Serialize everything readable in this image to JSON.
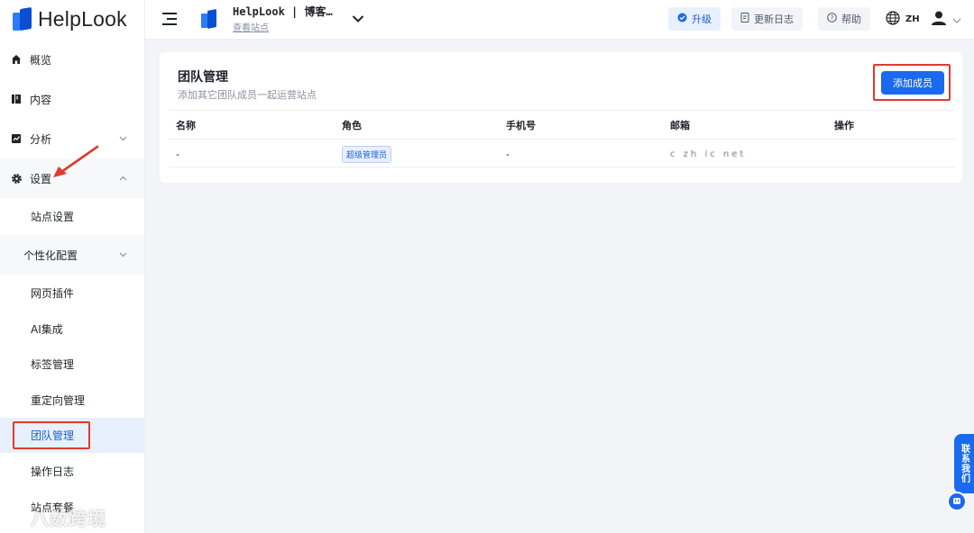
{
  "app": {
    "logo_text": "HelpLook"
  },
  "sidebar": {
    "items": [
      {
        "label": "概览",
        "icon": "home-icon"
      },
      {
        "label": "内容",
        "icon": "book-icon"
      },
      {
        "label": "分析",
        "icon": "chart-icon"
      },
      {
        "label": "设置",
        "icon": "gear-icon"
      },
      {
        "label": "站点设置"
      },
      {
        "label": "个性化配置"
      },
      {
        "label": "网页插件"
      },
      {
        "label": "AI集成"
      },
      {
        "label": "标签管理"
      },
      {
        "label": "重定向管理"
      },
      {
        "label": "团队管理"
      },
      {
        "label": "操作日志"
      },
      {
        "label": "站点套餐"
      }
    ]
  },
  "header": {
    "site_title": "HelpLook | 博客…",
    "site_link": "查看站点",
    "upgrade_label": "升级",
    "changelog_label": "更新日志",
    "help_label": "帮助",
    "lang": "ZH"
  },
  "main": {
    "title": "团队管理",
    "subtitle": "添加其它团队成员一起运营站点",
    "add_button": "添加成员",
    "columns": [
      "名称",
      "角色",
      "手机号",
      "邮箱",
      "操作"
    ],
    "rows": [
      {
        "name": "-",
        "role": "超级管理员",
        "phone": "-",
        "email": "c zh ic net"
      }
    ]
  },
  "floating": {
    "contact_label": "联系我们"
  },
  "watermark": {
    "text": "八数跨境"
  },
  "colors": {
    "accent": "#1a6af0",
    "annotation": "#e03a2e",
    "active_bg": "#e8f0fe"
  }
}
